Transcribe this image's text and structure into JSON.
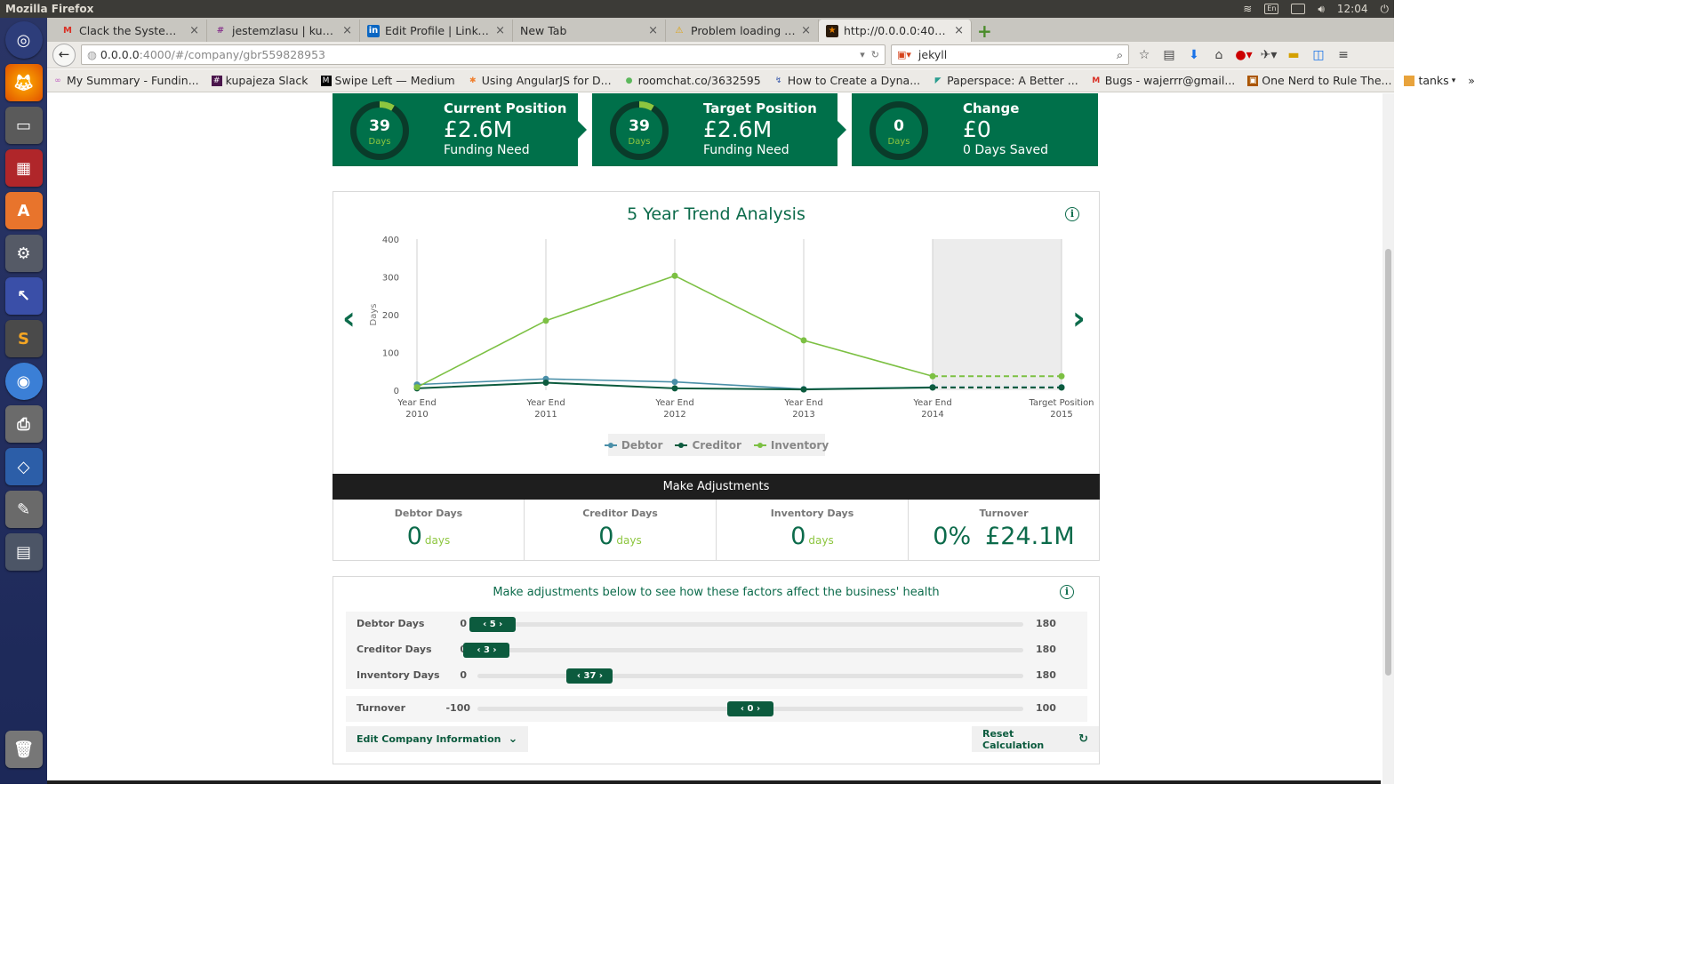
{
  "system": {
    "app_title": "Mozilla Firefox",
    "time": "12:04",
    "lang": "En"
  },
  "tabs": [
    {
      "label": "Clack the System - w...",
      "icon": "gmail-icon",
      "color": "#d93025",
      "glyph": "M"
    },
    {
      "label": "jestemzlasu | kupaje...",
      "icon": "slack-icon",
      "color": "#8a3a8f",
      "glyph": "#"
    },
    {
      "label": "Edit Profile | LinkedIn",
      "icon": "linkedin-icon",
      "color": "#0a66c2",
      "glyph": "in"
    },
    {
      "label": "New Tab",
      "icon": "",
      "color": "#888888",
      "glyph": ""
    },
    {
      "label": "Problem loading page",
      "icon": "warning-icon",
      "color": "#e0a000",
      "glyph": "⚠"
    },
    {
      "label": "http://0.0.0.0:4000/",
      "icon": "star-favicon-icon",
      "color": "#e07b00",
      "glyph": "★"
    }
  ],
  "nav": {
    "url_host": "0.0.0.0",
    "url_rest": ":4000/#/company/gbr559828953",
    "search_value": "jekyll"
  },
  "bookmarks": [
    {
      "label": "My Summary - Fundin...",
      "color": "#c060c0"
    },
    {
      "label": "kupajeza Slack",
      "color": "#4a154b"
    },
    {
      "label": "Swipe Left — Medium",
      "color": "#000000"
    },
    {
      "label": "Using AngularJS for D...",
      "color": "#f08030"
    },
    {
      "label": "roomchat.co/3632595",
      "color": "#5cb85c"
    },
    {
      "label": "How to Create a Dyna...",
      "color": "#3355aa"
    },
    {
      "label": "Paperspace: A Better ...",
      "color": "#2a9d8f"
    },
    {
      "label": "Bugs - wajerrr@gmail...",
      "color": "#d93025"
    },
    {
      "label": "One Nerd to Rule The...",
      "color": "#aa5500"
    },
    {
      "label": "tanks",
      "color": "#e8a33c"
    }
  ],
  "summary": [
    {
      "days": "39",
      "unit": "Days",
      "title": "Current Position",
      "value": "£2.6M",
      "sub": "Funding Need"
    },
    {
      "days": "39",
      "unit": "Days",
      "title": "Target Position",
      "value": "£2.6M",
      "sub": "Funding Need"
    },
    {
      "days": "0",
      "unit": "Days",
      "title": "Change",
      "value": "£0",
      "sub": "0 Days Saved"
    }
  ],
  "chart_data": {
    "type": "line",
    "title": "5 Year Trend Analysis",
    "ylabel": "Days",
    "ylim": [
      0,
      400
    ],
    "yticks": [
      0,
      100,
      200,
      300,
      400
    ],
    "categories": [
      [
        "Year End",
        "2010"
      ],
      [
        "Year End",
        "2011"
      ],
      [
        "Year End",
        "2012"
      ],
      [
        "Year End",
        "2013"
      ],
      [
        "Year End",
        "2014"
      ],
      [
        "Target Position",
        "2015"
      ]
    ],
    "projection_from_index": 4,
    "series": [
      {
        "name": "Debtor",
        "color": "#4a8fa8",
        "values": [
          15,
          30,
          22,
          3,
          8,
          8
        ]
      },
      {
        "name": "Creditor",
        "color": "#0c5b3e",
        "values": [
          5,
          20,
          5,
          2,
          7,
          7
        ]
      },
      {
        "name": "Inventory",
        "color": "#7cc043",
        "values": [
          8,
          184,
          303,
          132,
          37,
          37
        ]
      }
    ],
    "legend_position": "bottom"
  },
  "adjustments": {
    "header": "Make Adjustments",
    "stats": [
      {
        "label": "Debtor Days",
        "value": "0",
        "unit": "days"
      },
      {
        "label": "Creditor Days",
        "value": "0",
        "unit": "days"
      },
      {
        "label": "Inventory Days",
        "value": "0",
        "unit": "days"
      },
      {
        "label": "Turnover",
        "value": "0%",
        "value2": "£24.1M"
      }
    ]
  },
  "sliders": {
    "title": "Make adjustments below to see how these factors affect the business' health",
    "rows": [
      {
        "label": "Debtor Days",
        "min": "0",
        "max": "180",
        "value": "5",
        "fraction": 0.028
      },
      {
        "label": "Creditor Days",
        "min": "0",
        "max": "180",
        "value": "3",
        "fraction": 0.017
      },
      {
        "label": "Inventory Days",
        "min": "0",
        "max": "180",
        "value": "37",
        "fraction": 0.206
      },
      {
        "label": "Turnover",
        "min": "-100",
        "max": "100",
        "value": "0",
        "fraction": 0.5
      }
    ],
    "edit_label": "Edit Company Information",
    "reset_label": "Reset Calculation"
  }
}
